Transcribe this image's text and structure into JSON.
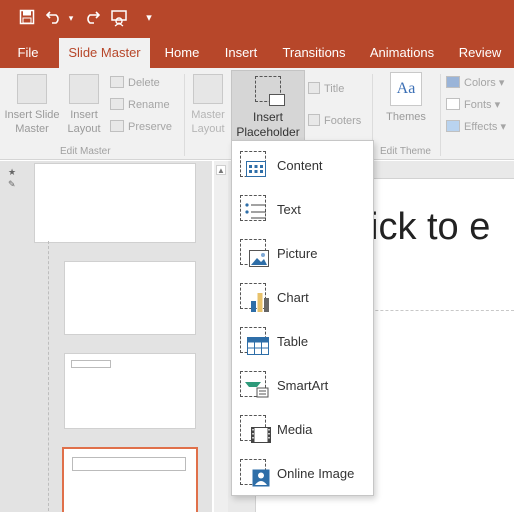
{
  "quick_access": {
    "save_icon": "save-icon",
    "undo_icon": "undo-icon",
    "redo_icon": "redo-icon",
    "present_icon": "presenter-icon",
    "customize_icon": "customize-qat-icon"
  },
  "tabs": [
    "File",
    "Slide Master",
    "Home",
    "Insert",
    "Transitions",
    "Animations",
    "Review"
  ],
  "ribbon": {
    "insert_slide_master": "Insert Slide\nMaster",
    "insert_layout": "Insert\nLayout",
    "delete": "Delete",
    "rename": "Rename",
    "preserve": "Preserve",
    "edit_master_label": "Edit Master",
    "master_layout": "Master\nLayout",
    "insert_placeholder": "Insert\nPlaceholder",
    "title": "Title",
    "footers": "Footers",
    "themes": "Themes",
    "colors": "Colors",
    "fonts": "Fonts",
    "effects": "Effects",
    "edit_theme_label": "Edit Theme"
  },
  "menu": {
    "items": [
      {
        "label": "Content",
        "icon": "content-placeholder-icon"
      },
      {
        "label": "Text",
        "icon": "text-placeholder-icon"
      },
      {
        "label": "Picture",
        "icon": "picture-placeholder-icon"
      },
      {
        "label": "Chart",
        "icon": "chart-placeholder-icon"
      },
      {
        "label": "Table",
        "icon": "table-placeholder-icon"
      },
      {
        "label": "SmartArt",
        "icon": "smartart-placeholder-icon"
      },
      {
        "label": "Media",
        "icon": "media-placeholder-icon"
      },
      {
        "label": "Online Image",
        "icon": "online-image-placeholder-icon"
      }
    ]
  },
  "slide": {
    "title_partial": "ick to e"
  },
  "colors": {
    "brand": "#b7472a",
    "ribbon_bg": "#f1f1f1"
  }
}
